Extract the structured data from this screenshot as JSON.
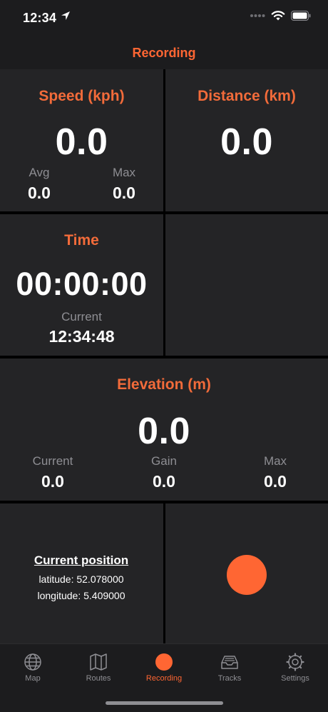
{
  "status_bar": {
    "time": "12:34"
  },
  "nav": {
    "title": "Recording"
  },
  "speed": {
    "title": "Speed (kph)",
    "value": "0.0",
    "avg_label": "Avg",
    "avg_value": "0.0",
    "max_label": "Max",
    "max_value": "0.0"
  },
  "distance": {
    "title": "Distance (km)",
    "value": "0.0"
  },
  "time": {
    "title": "Time",
    "value": "00:00:00",
    "current_label": "Current",
    "current_value": "12:34:48"
  },
  "elevation": {
    "title": "Elevation (m)",
    "value": "0.0",
    "current_label": "Current",
    "current_value": "0.0",
    "gain_label": "Gain",
    "gain_value": "0.0",
    "max_label": "Max",
    "max_value": "0.0"
  },
  "position": {
    "title": "Current position",
    "latitude": "latitude: 52.078000",
    "longitude": "longitude: 5.409000"
  },
  "tabs": [
    {
      "label": "Map",
      "icon": "globe-icon"
    },
    {
      "label": "Routes",
      "icon": "map-icon"
    },
    {
      "label": "Recording",
      "icon": "record-dot-icon",
      "active": true
    },
    {
      "label": "Tracks",
      "icon": "tray-icon"
    },
    {
      "label": "Settings",
      "icon": "gear-icon"
    }
  ],
  "colors": {
    "accent": "#ff6633",
    "background": "#000000",
    "panel": "#242426",
    "muted": "#8e8e93"
  }
}
